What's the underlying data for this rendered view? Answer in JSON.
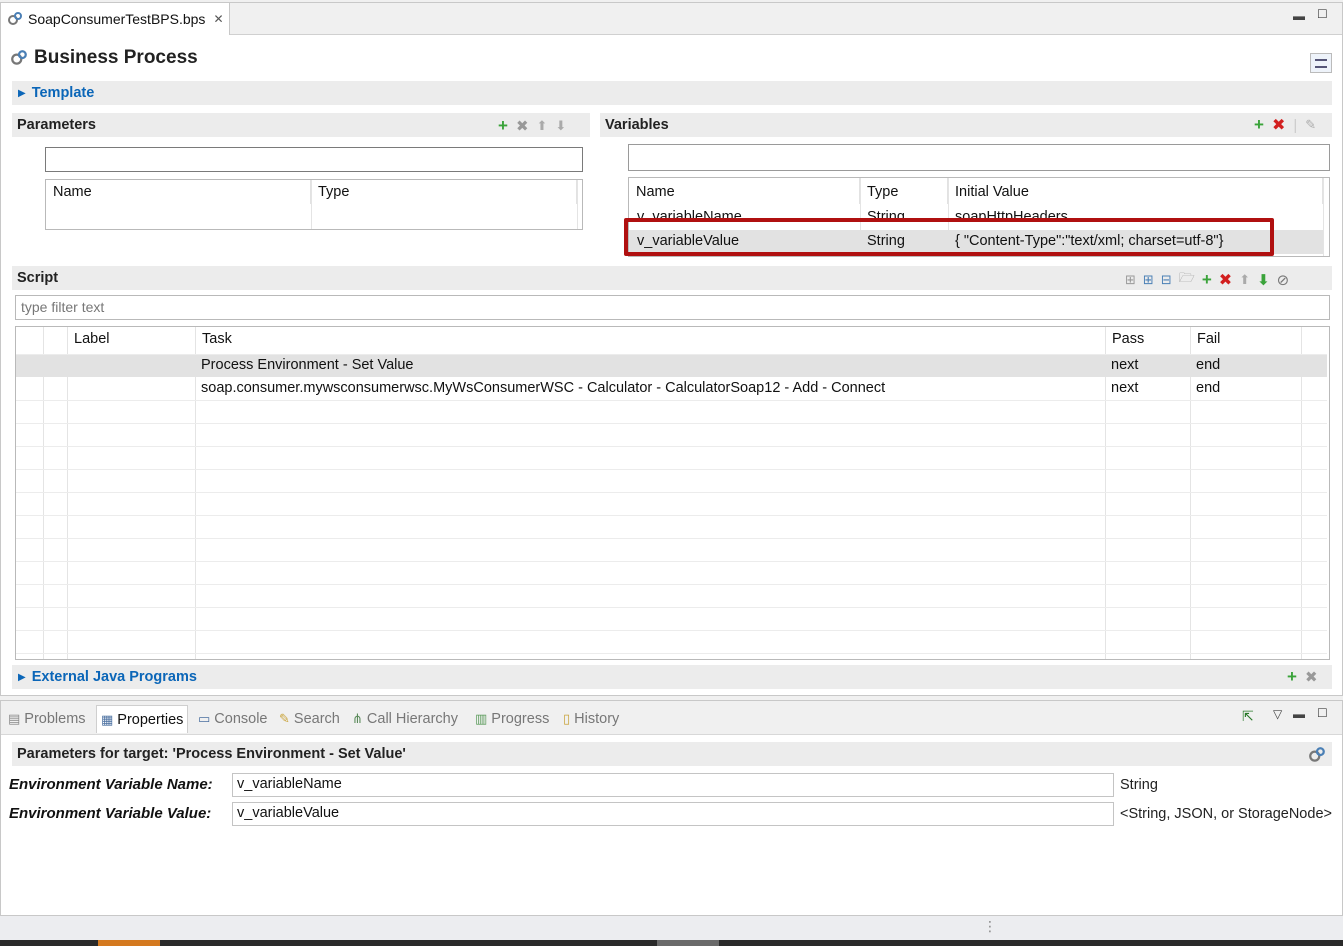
{
  "editor": {
    "tab_label": "SoapConsumerTestBPS.bps",
    "title": "Business Process",
    "template_section": "Template",
    "parameters": {
      "section": "Parameters",
      "filter_value": "",
      "columns": [
        "Name",
        "Type"
      ]
    },
    "variables": {
      "section": "Variables",
      "filter_value": "",
      "columns": [
        "Name",
        "Type",
        "Initial Value"
      ],
      "rows": [
        {
          "name": "v_variableName",
          "type": "String",
          "initial": "soapHttpHeaders"
        },
        {
          "name": "v_variableValue",
          "type": "String",
          "initial": "{ \"Content-Type\":\"text/xml; charset=utf-8\"}"
        }
      ]
    },
    "script": {
      "section": "Script",
      "filter_placeholder": "type filter text",
      "columns": [
        "Label",
        "Task",
        "Pass",
        "Fail"
      ],
      "rows": [
        {
          "label": "",
          "task": "Process Environment - Set Value",
          "pass": "next",
          "fail": "end"
        },
        {
          "label": "",
          "task": "soap.consumer.mywsconsumerwsc.MyWsConsumerWSC - Calculator - CalculatorSoap12 - Add - Connect",
          "pass": "next",
          "fail": "end"
        }
      ]
    },
    "external_section": "External Java Programs"
  },
  "views": {
    "tabs": [
      "Problems",
      "Properties",
      "Console",
      "Search",
      "Call Hierarchy",
      "Progress",
      "History"
    ],
    "active_tab": "Properties",
    "properties": {
      "header": "Parameters for target: 'Process Environment - Set Value'",
      "fields": [
        {
          "label": "Environment Variable Name:",
          "value": "v_variableName",
          "type": "String"
        },
        {
          "label": "Environment Variable Value:",
          "value": "v_variableValue",
          "type": "<String, JSON, or StorageNode>"
        }
      ]
    }
  },
  "colors": {
    "highlight_box": "#b01010",
    "link_blue": "#0b66b8",
    "add_green": "#3aa33a",
    "delete_red": "#d21f1f"
  }
}
